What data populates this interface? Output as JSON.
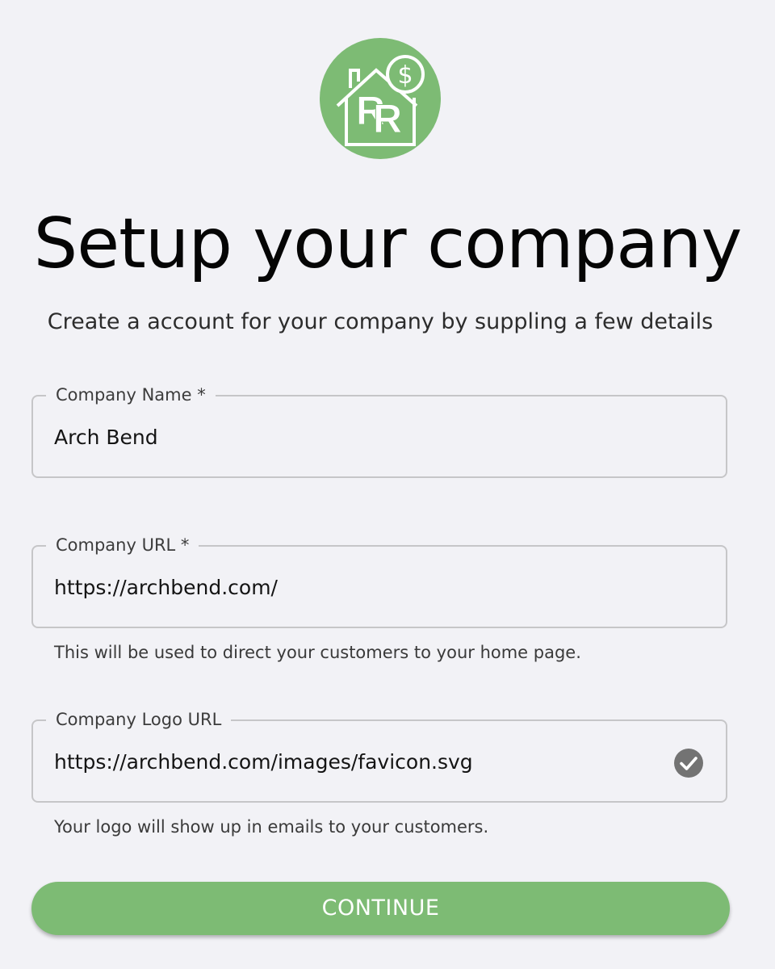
{
  "logo": {
    "icon": "house-dollar-logo",
    "letters": "RR",
    "brand_color": "#7dbb74"
  },
  "page": {
    "title": "Setup your company",
    "subtitle": "Create a account for your company by suppling a few details"
  },
  "form": {
    "company_name": {
      "label": "Company Name *",
      "value": "Arch Bend"
    },
    "company_url": {
      "label": "Company URL *",
      "value": "https://archbend.com/",
      "helper": "This will be used to direct your customers to your home page."
    },
    "company_logo_url": {
      "label": "Company Logo URL",
      "value": "https://archbend.com/images/favicon.svg",
      "helper": "Your logo will show up in emails to your customers.",
      "status_icon": "check-circle-icon"
    }
  },
  "actions": {
    "continue_label": "CONTINUE"
  }
}
